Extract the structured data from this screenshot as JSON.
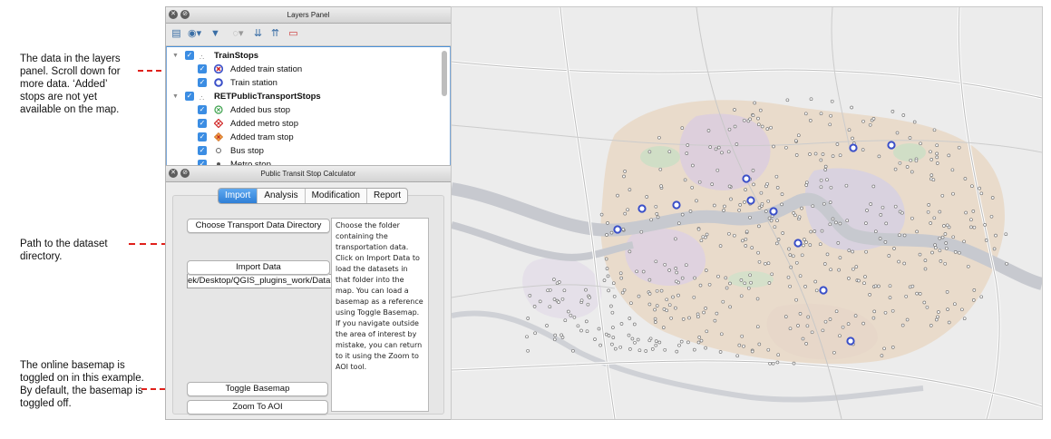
{
  "annotations": {
    "layers_note": "The data in the layers panel. Scroll down for more data. ‘Added’ stops are not yet available on the map.",
    "path_note": "Path to the dataset directory.",
    "basemap_note": "The online basemap is toggled on in this example. By default, the basemap is toggled off."
  },
  "colors": {
    "annotation_arrow": "#e0211b",
    "accent": "#2f7fd6",
    "stop_ring": "#3a4fc8"
  },
  "layers_panel": {
    "title": "Layers Panel",
    "toolbar_icons": [
      "open-layer-styling-icon",
      "add-group-icon",
      "filter-legend-icon",
      "manage-visibility-icon",
      "expand-all-icon",
      "collapse-all-icon",
      "remove-layer-icon"
    ],
    "items": [
      {
        "label": "TrainStops",
        "kind": "group",
        "icon": "point-layer-icon"
      },
      {
        "label": "Added train station",
        "kind": "layer",
        "icon": "added-train-station-symbol-icon"
      },
      {
        "label": "Train station",
        "kind": "layer",
        "icon": "train-station-symbol-icon"
      },
      {
        "label": "RETPublicTransportStops",
        "kind": "group",
        "icon": "point-layer-icon"
      },
      {
        "label": "Added bus stop",
        "kind": "layer",
        "icon": "added-bus-stop-symbol-icon"
      },
      {
        "label": "Added metro stop",
        "kind": "layer",
        "icon": "added-metro-stop-symbol-icon"
      },
      {
        "label": "Added tram stop",
        "kind": "layer",
        "icon": "added-tram-stop-symbol-icon"
      },
      {
        "label": "Bus stop",
        "kind": "layer",
        "icon": "bus-stop-symbol-icon"
      },
      {
        "label": "Metro stop",
        "kind": "layer",
        "icon": "metro-stop-symbol-icon"
      }
    ]
  },
  "calculator": {
    "title": "Public Transit Stop Calculator",
    "tabs": [
      "Import",
      "Analysis",
      "Modification",
      "Report"
    ],
    "active_tab": "Import",
    "choose_button": "Choose Transport Data Directory",
    "path_value": "ek/Desktop/QGIS_plugins_work/Data",
    "import_button": "Import Data",
    "toggle_button": "Toggle Basemap",
    "zoom_button": "Zoom To AOI",
    "help_text": "Choose the folder containing the transportation data. Click on Import Data to load the datasets in that folder into the map. You can load a basemap as a reference using Toggle Basemap. If you navigate outside the area of interest by mistake, you can return to it using the Zoom to AOI tool."
  }
}
